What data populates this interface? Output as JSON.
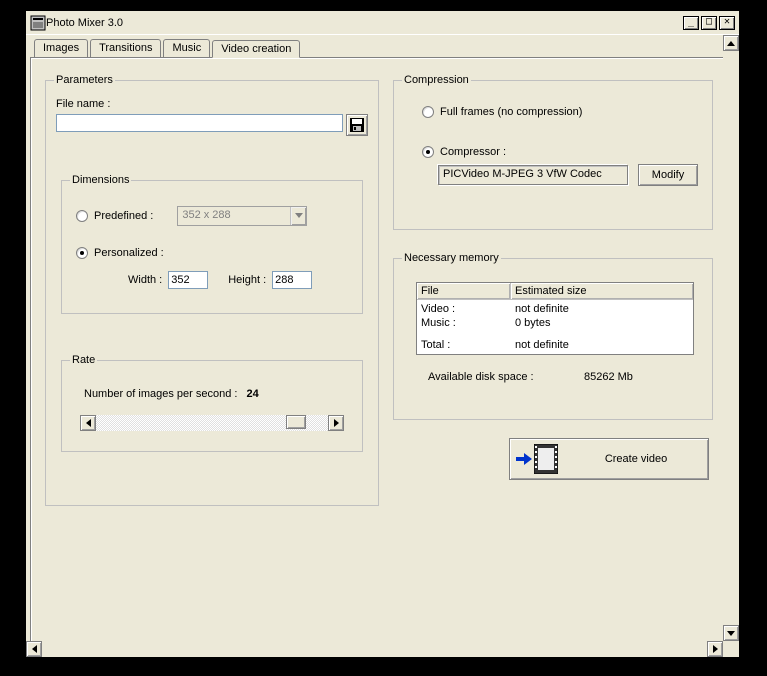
{
  "window": {
    "title": "Photo Mixer 3.0"
  },
  "tabs": {
    "images": "Images",
    "transitions": "Transitions",
    "music": "Music",
    "video_creation": "Video creation"
  },
  "parameters": {
    "legend": "Parameters",
    "file_name_label": "File name :",
    "file_name_value": ""
  },
  "dimensions": {
    "legend": "Dimensions",
    "predefined_label": "Predefined :",
    "predefined_value": "352 x 288",
    "personalized_label": "Personalized :",
    "width_label": "Width :",
    "width_value": "352",
    "height_label": "Height :",
    "height_value": "288"
  },
  "rate": {
    "legend": "Rate",
    "images_per_sec_label": "Number of images per second :",
    "images_per_sec_value": "24"
  },
  "compression": {
    "legend": "Compression",
    "full_frames_label": "Full frames (no compression)",
    "compressor_label": "Compressor :",
    "codec_value": "PICVideo M-JPEG 3 VfW Codec",
    "modify_label": "Modify"
  },
  "memory": {
    "legend": "Necessary memory",
    "col_file": "File",
    "col_size": "Estimated size",
    "rows": {
      "video_label": "Video :",
      "video_val": "not definite",
      "music_label": "Music :",
      "music_val": "0 bytes",
      "total_label": "Total :",
      "total_val": "not definite"
    },
    "disk_label": "Available disk space :",
    "disk_value": "85262 Mb"
  },
  "create_button": "Create video"
}
